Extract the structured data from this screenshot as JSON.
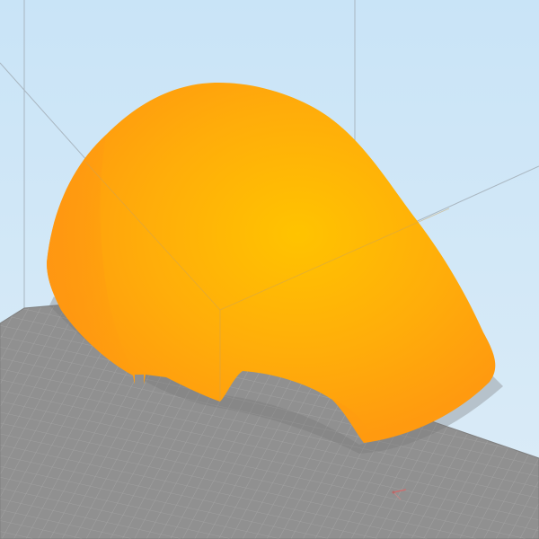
{
  "viewport": {
    "background_top": "#c9e4f7",
    "background_bottom": "#dcecf7",
    "build_volume_edge_color": "#a9b6c0"
  },
  "build_plate": {
    "fill_color": "#909090",
    "grid_color": "#a9a9a9",
    "edge_color": "#7f7f7f"
  },
  "model": {
    "color_highlight": "#ffc300",
    "color_mid": "#ffad0a",
    "color_shadow": "#ff9710",
    "cutout_color": "#909090"
  },
  "icons": {
    "origin_axes": "origin-axes-icon"
  }
}
